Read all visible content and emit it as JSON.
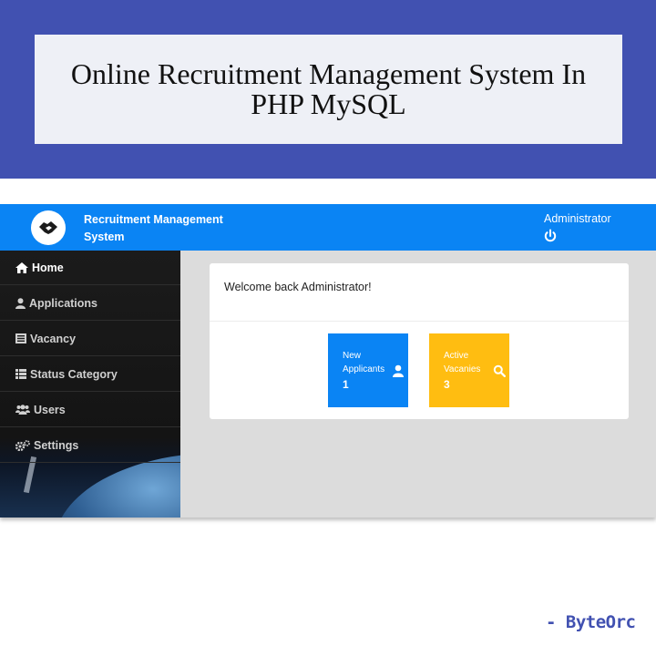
{
  "banner": {
    "title": "Online Recruitment Management System In PHP MySQL"
  },
  "app": {
    "name": "Recruitment Management System",
    "user": "Administrator",
    "icons": {
      "logo": "handshake-icon",
      "logout": "power-icon"
    },
    "colors": {
      "topbar": "#0a84f4",
      "sidebar": "#1b1b1b",
      "blue_tile": "#0a84f4",
      "yellow_tile": "#ffbd11"
    }
  },
  "sidebar": {
    "items": [
      {
        "label": "Home",
        "icon": "home-icon",
        "active": true
      },
      {
        "label": "Applications",
        "icon": "user-icon",
        "active": false
      },
      {
        "label": "Vacancy",
        "icon": "list-alt-icon",
        "active": false
      },
      {
        "label": "Status Category",
        "icon": "list-icon",
        "active": false
      },
      {
        "label": "Users",
        "icon": "users-icon",
        "active": false
      },
      {
        "label": "Settings",
        "icon": "cogs-icon",
        "active": false
      }
    ]
  },
  "main": {
    "welcome": "Welcome back Administrator!",
    "tiles": [
      {
        "label": "New Applicants",
        "value": "1",
        "icon": "user-icon"
      },
      {
        "label": "Active Vacanies",
        "value": "3",
        "icon": "search-icon"
      }
    ]
  },
  "credit": "- ByteOrc"
}
